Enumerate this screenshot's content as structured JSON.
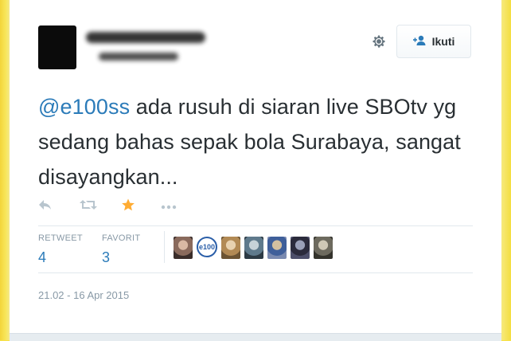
{
  "tweet": {
    "mention": "@e100ss",
    "text_lines": [
      " ada rusuh di siaran live SBOtv yg",
      "sedang bahas sepak bola Surabaya, sangat",
      "disayangkan..."
    ],
    "timestamp": "21.02 - 16 Apr 2015"
  },
  "header": {
    "follow_label": "Ikuti"
  },
  "stats": {
    "retweet_label": "RETWEET",
    "retweet_count": "4",
    "favorite_label": "FAVORIT",
    "favorite_count": "3"
  },
  "engagers": [
    {
      "kind": "photo",
      "colors": [
        "#8a6a5c",
        "#d9b9a4",
        "#3a2d2a"
      ]
    },
    {
      "kind": "logo",
      "label": "e100"
    },
    {
      "kind": "photo",
      "colors": [
        "#b28a55",
        "#e8d2b0",
        "#6c5434"
      ]
    },
    {
      "kind": "photo",
      "colors": [
        "#5f7a8c",
        "#c7d2d8",
        "#2d3b45"
      ]
    },
    {
      "kind": "photo",
      "colors": [
        "#3f5f9a",
        "#d4c0a0",
        "#7a8ab0"
      ]
    },
    {
      "kind": "photo",
      "colors": [
        "#2b2b3c",
        "#9aa0b8",
        "#4d4f6a"
      ]
    },
    {
      "kind": "photo",
      "colors": [
        "#6d6a5e",
        "#cfc8b6",
        "#34332c"
      ]
    }
  ],
  "colors": {
    "link": "#2b7bb9",
    "favorite_star": "#ffac33",
    "muted": "#8899a6",
    "border_yellow": "#f7e24a"
  },
  "icons": {
    "reply": "reply-icon",
    "retweet": "retweet-icon",
    "favorite": "star-icon",
    "more": "more-icon",
    "settings": "gear-icon",
    "follow": "add-user-icon"
  }
}
